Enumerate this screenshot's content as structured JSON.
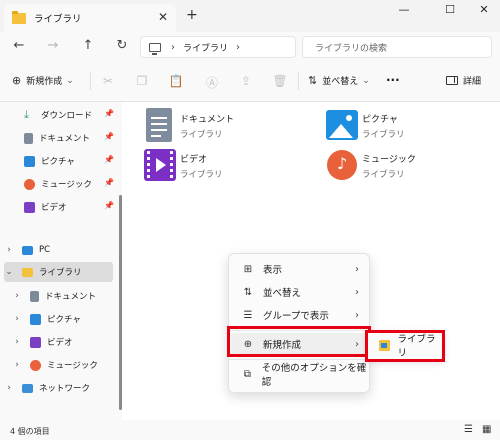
{
  "window": {
    "tab_title": "ライブラリ",
    "tab_close": "✕",
    "new_tab": "+",
    "minimize": "—",
    "maximize": "☐",
    "close": "✕"
  },
  "nav": {
    "back": "←",
    "forward": "→",
    "up": "↑",
    "refresh": "↻"
  },
  "address": {
    "sep": "›",
    "crumb": "ライブラリ",
    "sep2": "›"
  },
  "search": {
    "placeholder": "ライブラリの検索"
  },
  "toolbar": {
    "new_label": "新規作成",
    "new_chevron": "⌄",
    "sort_label": "並べ替え",
    "sort_chevron": "⌄",
    "more": "···",
    "details_label": "詳細"
  },
  "sidebar": {
    "pin": "📌",
    "quick": [
      {
        "label": "ダウンロード"
      },
      {
        "label": "ドキュメント"
      },
      {
        "label": "ピクチャ"
      },
      {
        "label": "ミュージック"
      },
      {
        "label": "ビデオ"
      }
    ],
    "tree": [
      {
        "label": "PC",
        "chevron": "›"
      },
      {
        "label": "ライブラリ",
        "chevron": "⌄"
      },
      {
        "label": "ドキュメント",
        "chevron": "›"
      },
      {
        "label": "ピクチャ",
        "chevron": "›"
      },
      {
        "label": "ビデオ",
        "chevron": "›"
      },
      {
        "label": "ミュージック",
        "chevron": "›"
      },
      {
        "label": "ネットワーク",
        "chevron": "›"
      }
    ]
  },
  "libraries": [
    {
      "name": "ドキュメント",
      "sub": "ライブラリ"
    },
    {
      "name": "ピクチャ",
      "sub": "ライブラリ"
    },
    {
      "name": "ビデオ",
      "sub": "ライブラリ"
    },
    {
      "name": "ミュージック",
      "sub": "ライブラリ"
    }
  ],
  "context_menu": {
    "items": [
      {
        "label": "表示",
        "icon": "⊞",
        "arrow": "›"
      },
      {
        "label": "並べ替え",
        "icon": "⇅",
        "arrow": "›"
      },
      {
        "label": "グループで表示",
        "icon": "☰",
        "arrow": "›"
      },
      {
        "label": "新規作成",
        "icon": "⊕",
        "arrow": "›"
      },
      {
        "label": "その他のオプションを確認",
        "icon": "⧉",
        "arrow": ""
      }
    ],
    "submenu_item": "ライブラリ"
  },
  "status": {
    "count": "4 個の項目",
    "view_list": "☰",
    "view_tiles": "▦"
  },
  "colors": {
    "folder": "#f5c13a",
    "highlight_border": "#e60012",
    "accent": "#0067c0"
  }
}
